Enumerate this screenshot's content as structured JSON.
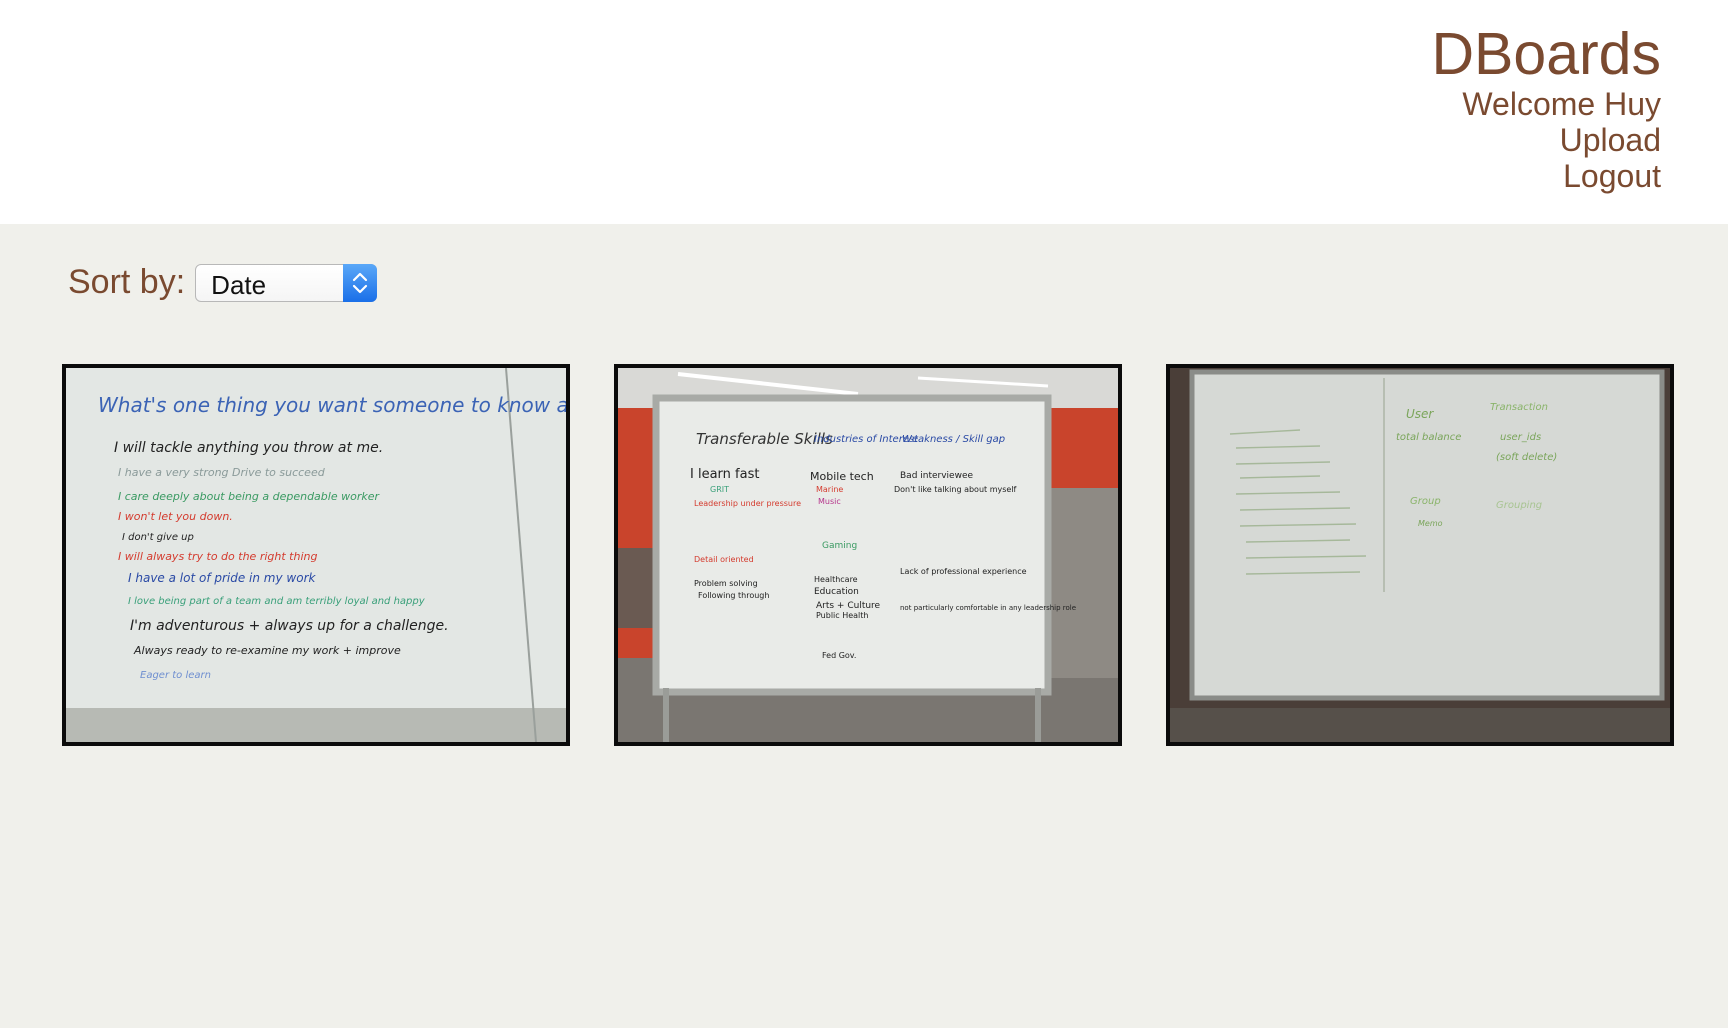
{
  "header": {
    "brand": "DBoards",
    "welcome": "Welcome Huy",
    "upload": "Upload",
    "logout": "Logout"
  },
  "sort": {
    "label": "Sort by:",
    "selected": "Date"
  },
  "boards": [
    {
      "lines": [
        "What's one thing you want someone to know about you?",
        "I will tackle anything you throw at me.",
        "I have a very strong Drive to succeed",
        "I care deeply about being a dependable worker",
        "I won't let you down.",
        "I don't give up",
        "I will always try to do the right thing",
        "I have a lot of pride in my work",
        "I love being part of a team and am terribly loyal and happy",
        "I'm adventurous + always up for a challenge.",
        "Always ready to re-examine my work + improve",
        "Eager to learn"
      ]
    },
    {
      "columns": [
        {
          "heading": "Transferable Skills",
          "lines": [
            "I learn fast",
            "GRIT",
            "Leadership under pressure",
            "Detail oriented",
            "Problem solving",
            "Following through"
          ]
        },
        {
          "heading": "Industries of Interest",
          "lines": [
            "Mobile tech",
            "Marine",
            "Music",
            "Gaming",
            "Healthcare",
            "Education",
            "Arts + Culture",
            "Public Health",
            "Fed Gov."
          ]
        },
        {
          "heading": "Weakness / Skill gap",
          "lines": [
            "Bad interviewee",
            "Don't like talking about myself",
            "Lack of professional experience",
            "not particularly comfortable in any leadership role"
          ]
        }
      ]
    },
    {
      "lines": [
        "User",
        "total balance",
        "Transaction",
        "user_ids",
        "(soft delete)",
        "Group",
        "Grouping",
        "Memo"
      ]
    }
  ],
  "colors": {
    "brand": "#7a4a30",
    "header_bg": "#ffffff",
    "page_bg": "#f0f0eb",
    "select_accent": "#1a6fe8"
  }
}
